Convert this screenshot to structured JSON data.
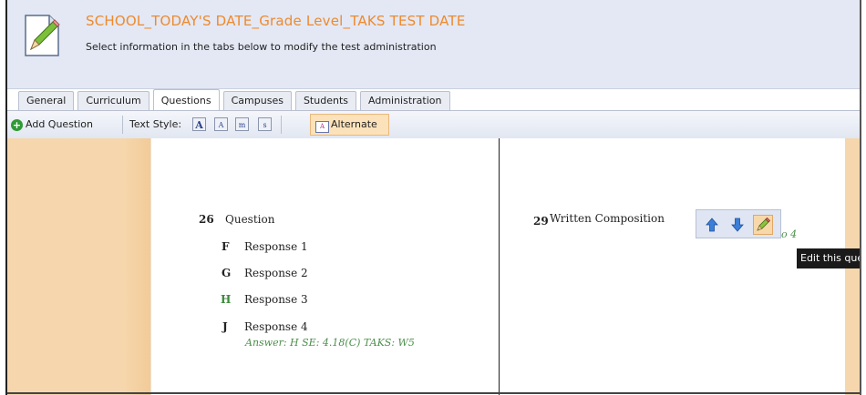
{
  "header": {
    "title": "SCHOOL_TODAY'S DATE_Grade Level_TAKS TEST DATE",
    "subtitle": "Select information in the tabs below to modify the test administration"
  },
  "tabs": [
    {
      "label": "General"
    },
    {
      "label": "Curriculum"
    },
    {
      "label": "Questions",
      "active": true
    },
    {
      "label": "Campuses"
    },
    {
      "label": "Students"
    },
    {
      "label": "Administration"
    }
  ],
  "toolbar": {
    "add_question": "Add Question",
    "text_style_label": "Text Style:",
    "style_buttons": [
      "A",
      "A",
      "m",
      "s"
    ],
    "alternate_icon_text": "A",
    "alternate_label": "Alternate"
  },
  "questions": [
    {
      "number": "26",
      "text": "Question",
      "responses": [
        {
          "letter": "F",
          "text": "Response 1"
        },
        {
          "letter": "G",
          "text": "Response 2"
        },
        {
          "letter": "H",
          "text": "Response 3",
          "correct": true
        },
        {
          "letter": "J",
          "text": "Response 4"
        }
      ],
      "answer_line": "Answer: H  SE: 4.18(C)  TAKS: W5"
    },
    {
      "number": "29",
      "text": "Written Composition",
      "answer_line": "Answer: 0 to 4"
    }
  ],
  "controls": {
    "icons": [
      "arrow-up-icon",
      "arrow-down-icon",
      "pencil-icon"
    ],
    "tooltip": "Edit this question"
  },
  "colors": {
    "title_orange": "#ee8a2e",
    "correct_green": "#3b8a3b",
    "sidebar_tan": "#f6d7ad",
    "header_bg": "#e3e8f4"
  }
}
